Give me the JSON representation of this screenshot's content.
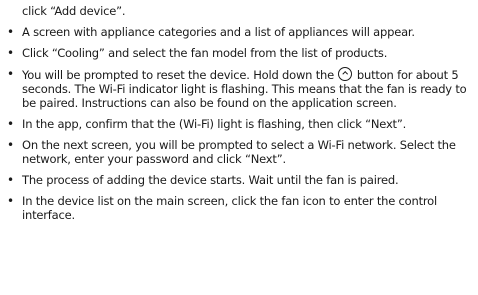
{
  "steps": [
    {
      "text": "In the upper right corner of the main screen, click “Add device” or “+”, then click “Add device”."
    },
    {
      "text": "A screen with appliance categories and a list of appliances will appear."
    },
    {
      "text": "Click “Cooling” and select the fan model from the list of products."
    },
    {
      "text_before": "You will be prompted to reset the device. Hold down the ",
      "icon": "chevron-up-circle-icon",
      "text_after": " button for about 5 seconds. The Wi-Fi indicator light is flashing. This means that the fan is ready to be paired. Instructions can also be found on the application screen."
    },
    {
      "text": "In the app, confirm that the (Wi-Fi) light is flashing, then click “Next”."
    },
    {
      "text": "On the next screen, you will be prompted to select a Wi-Fi network. Select the network, enter your password and click “Next”."
    },
    {
      "text": "The process of adding the device starts. Wait until the fan is paired."
    },
    {
      "text": "In the device list on the main screen, click the fan icon to enter the control interface."
    }
  ]
}
